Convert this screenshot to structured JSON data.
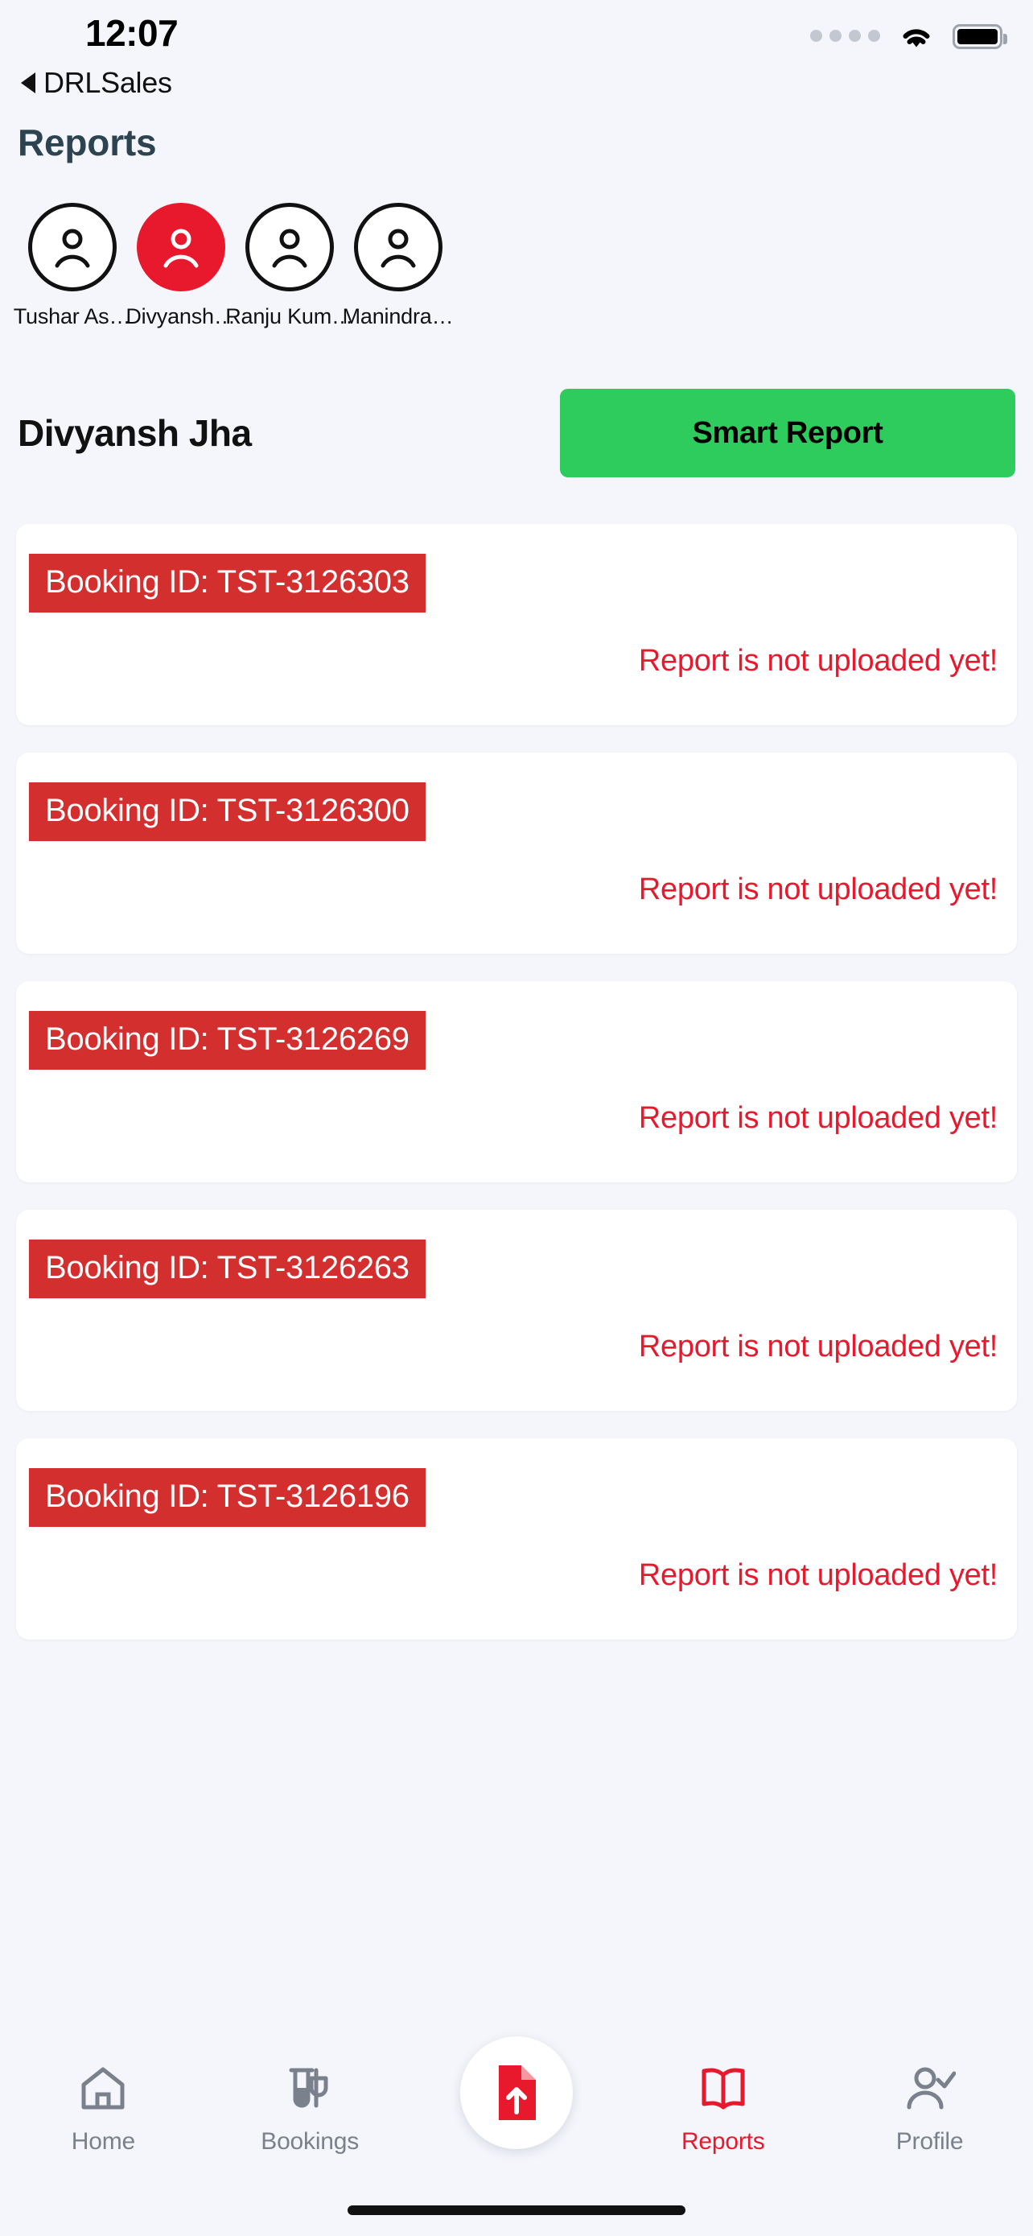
{
  "status_bar": {
    "time": "12:07",
    "wifi_icon": "wifi-icon",
    "battery_icon": "battery-full-icon",
    "signal_icon": "signal-dots-icon"
  },
  "back_nav": {
    "caret_icon": "back-caret-icon",
    "label": "DRLSales"
  },
  "header": {
    "title": "Reports",
    "title_color": "#2d4450"
  },
  "avatars": {
    "items": [
      {
        "name": "Tushar As…",
        "icon": "person-circle-icon",
        "active": false
      },
      {
        "name": "Divyansh…",
        "icon": "person-circle-icon",
        "active": true
      },
      {
        "name": "Ranju Kum…",
        "icon": "person-circle-icon",
        "active": false
      },
      {
        "name": "Manindra…",
        "icon": "person-circle-icon",
        "active": false
      }
    ],
    "active_color": "#e8192c"
  },
  "selection": {
    "person_name": "Divyansh Jha",
    "smart_report_label": "Smart Report",
    "smart_report_color": "#2ecc5d"
  },
  "bookings": {
    "status_color": "#e8192c",
    "banner_color": "#d32f2f",
    "items": [
      {
        "booking_label": "Booking ID: TST-3126303",
        "status": "Report is not uploaded yet!"
      },
      {
        "booking_label": "Booking ID: TST-3126300",
        "status": "Report is not uploaded yet!"
      },
      {
        "booking_label": "Booking ID: TST-3126269",
        "status": "Report is not uploaded yet!"
      },
      {
        "booking_label": "Booking ID: TST-3126263",
        "status": "Report is not uploaded yet!"
      },
      {
        "booking_label": "Booking ID: TST-3126196",
        "status": "Report is not uploaded yet!"
      }
    ]
  },
  "tabbar": {
    "active_color": "#e8192c",
    "inactive_color": "#7b818c",
    "items": [
      {
        "label": "Home",
        "icon": "home-icon",
        "active": false
      },
      {
        "label": "Bookings",
        "icon": "test-tube-icon",
        "active": false
      },
      {
        "label": "Reports",
        "icon": "open-book-icon",
        "active": true
      },
      {
        "label": "Profile",
        "icon": "person-check-icon",
        "active": false
      }
    ],
    "fab": {
      "icon": "document-upload-icon"
    }
  }
}
